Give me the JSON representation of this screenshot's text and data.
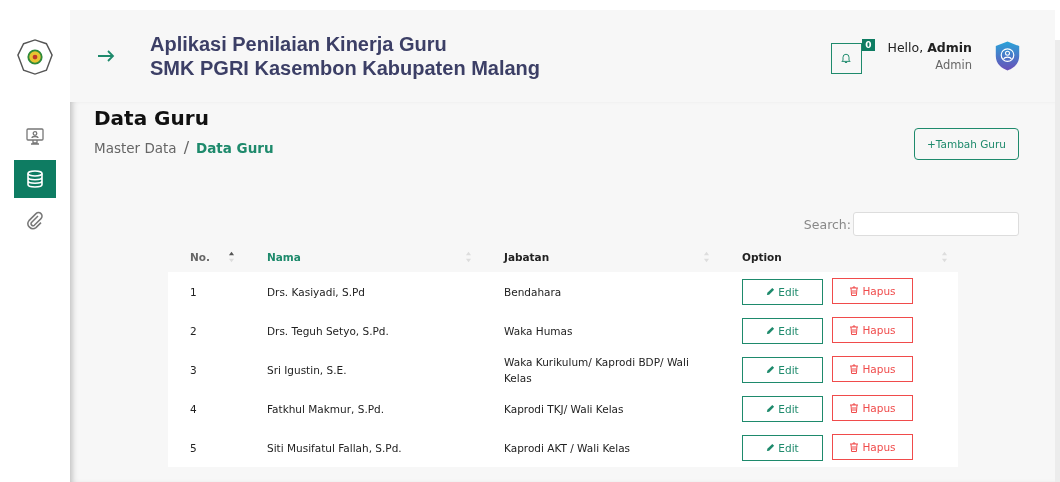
{
  "header": {
    "title_line_1": "Aplikasi Penilaian Kinerja Guru",
    "title_line_2": "SMK PGRI Kasembon Kabupaten Malang",
    "notification_count": "0",
    "greeting": "Hello, **Admin**",
    "role": "Admin"
  },
  "sidebar": {
    "items": [
      {
        "kind": "monitor",
        "selected": false
      },
      {
        "kind": "database",
        "selected": true
      },
      {
        "kind": "paperclip",
        "selected": false
      }
    ]
  },
  "page": {
    "title": "Data Guru",
    "breadcrumb": [
      "Master Data",
      "Data Guru"
    ],
    "breadcrumb_separator": "/",
    "add_button": "+Tambah Guru"
  },
  "table": {
    "search_label": "Search:",
    "columns": [
      {
        "label": "No.",
        "sorted": true
      },
      {
        "label": "Nama",
        "sorted": false
      },
      {
        "label": "Jabatan",
        "sorted": false
      },
      {
        "label": "Option",
        "sorted": false
      }
    ],
    "rows": [
      {
        "no": "1",
        "nama": "Drs. Kasiyadi, S.Pd",
        "jabatan": "Bendahara",
        "edit": "Edit",
        "delete": "Hapus"
      },
      {
        "no": "2",
        "nama": "Drs. Teguh Setyo, S.Pd.",
        "jabatan": "Waka Humas",
        "edit": "Edit",
        "delete": "Hapus"
      },
      {
        "no": "3",
        "nama": "Sri Igustin, S.E.",
        "jabatan": "Waka Kurikulum/ Kaprodi BDP/ Wali Kelas",
        "edit": "Edit",
        "delete": "Hapus"
      },
      {
        "no": "4",
        "nama": "Fatkhul Makmur, S.Pd.",
        "jabatan": "Kaprodi TKJ/ Wali Kelas",
        "edit": "Edit",
        "delete": "Hapus"
      },
      {
        "no": "5",
        "nama": "Siti Musifatul Fallah, S.Pd.",
        "jabatan": "Kaprodi AKT / Wali Kelas",
        "edit": "Edit",
        "delete": "Hapus"
      }
    ]
  }
}
